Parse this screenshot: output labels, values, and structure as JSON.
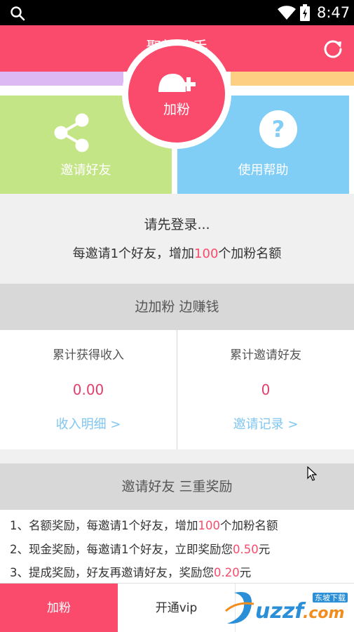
{
  "status_bar": {
    "time": "8:47"
  },
  "header": {
    "title": "聚粉助手"
  },
  "tiles": {
    "add_fans": "加粉",
    "invite_friends": "邀请好友",
    "help": "使用帮助"
  },
  "login": {
    "prompt": "请先登录...",
    "reward_prefix": "每邀请1个好友，增加",
    "reward_count": "100",
    "reward_suffix": "个加粉名额"
  },
  "earn_section": {
    "title": "边加粉 边赚钱"
  },
  "stats": {
    "income": {
      "label": "累计获得收入",
      "value": "0.00",
      "link": "收入明细 >"
    },
    "invites": {
      "label": "累计邀请好友",
      "value": "0",
      "link": "邀请记录 >"
    }
  },
  "rewards_section": {
    "title": "邀请好友 三重奖励",
    "items": [
      {
        "prefix": "1、名额奖励，每邀请1个好友，增加",
        "highlight": "100",
        "suffix": "个加粉名额"
      },
      {
        "prefix": "2、现金奖励，每邀请1个好友，立即奖励您",
        "highlight": "0.50",
        "suffix": "元"
      },
      {
        "prefix": "3、提成奖励，好友再邀请好友，奖励您",
        "highlight": "0.20",
        "suffix": "元"
      }
    ]
  },
  "tabs": {
    "add_fans": "加粉",
    "vip": "开通vip"
  },
  "watermark": {
    "text": "uzzf.com",
    "sub": "东坡下载"
  },
  "colors": {
    "brand": "#fb4b6c",
    "green_tile": "#c4e586",
    "blue_tile": "#80cdf5",
    "link": "#7fc6f0"
  },
  "icons": [
    "search-icon",
    "wifi-icon",
    "battery-icon",
    "refresh-icon",
    "add-user-icon",
    "share-icon",
    "question-icon"
  ]
}
